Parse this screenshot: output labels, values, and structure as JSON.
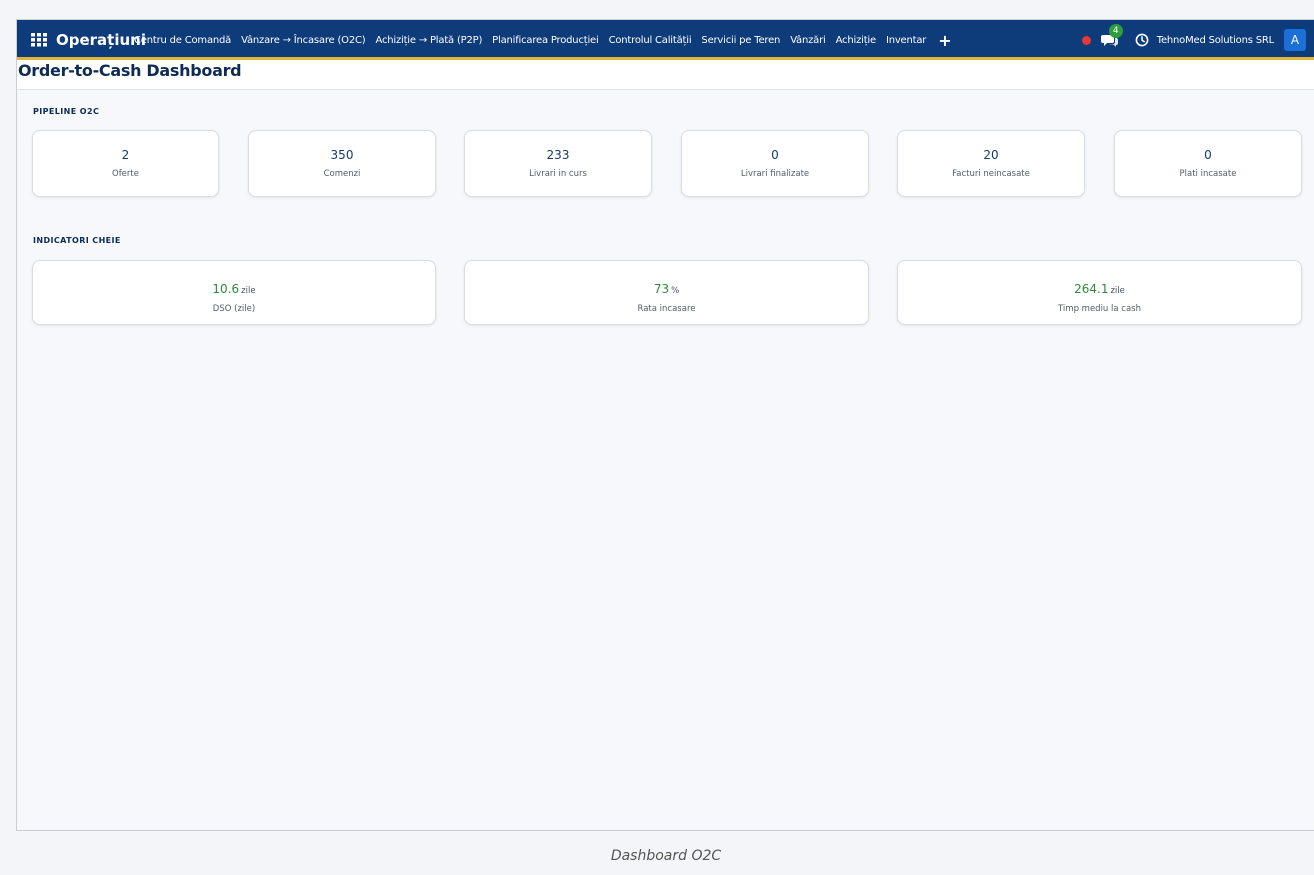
{
  "navbar": {
    "brand": "Operațiuni",
    "menu": [
      "Centru de Comandă",
      "Vânzare → Încasare (O2C)",
      "Achiziție → Plată (P2P)",
      "Planificarea Producției",
      "Controlul Calității",
      "Servicii pe Teren",
      "Vânzări",
      "Achiziție",
      "Inventar"
    ],
    "plus": "+",
    "chat_count": "4",
    "company": "TehnoMed Solutions SRL",
    "avatar": "A"
  },
  "page": {
    "title": "Order-to-Cash Dashboard"
  },
  "pipeline": {
    "label": "PIPELINE O2C",
    "cards": [
      {
        "value": "2",
        "label": "Oferte"
      },
      {
        "value": "350",
        "label": "Comenzi"
      },
      {
        "value": "233",
        "label": "Livrari in curs"
      },
      {
        "value": "0",
        "label": "Livrari finalizate"
      },
      {
        "value": "20",
        "label": "Facturi neincasate"
      },
      {
        "value": "0",
        "label": "Plati incasate"
      }
    ]
  },
  "indicators": {
    "label": "INDICATORI CHEIE",
    "cards": [
      {
        "value": "10.6",
        "unit": "zile",
        "label": "DSO (zile)"
      },
      {
        "value": "73",
        "unit": "%",
        "label": "Rata incasare"
      },
      {
        "value": "264.1",
        "unit": "zile",
        "label": "Timp mediu la cash"
      }
    ]
  },
  "caption": "Dashboard O2C",
  "colors": {
    "navbar": "#0e3b7a",
    "accent": "#e3b63a",
    "kpi_value": "#2e8b3a",
    "badge": "#2e9d3b",
    "record": "#e53935"
  },
  "icons": [
    "apps-grid-icon",
    "record-dot-icon",
    "chat-icon",
    "clock-icon",
    "plus-icon"
  ]
}
